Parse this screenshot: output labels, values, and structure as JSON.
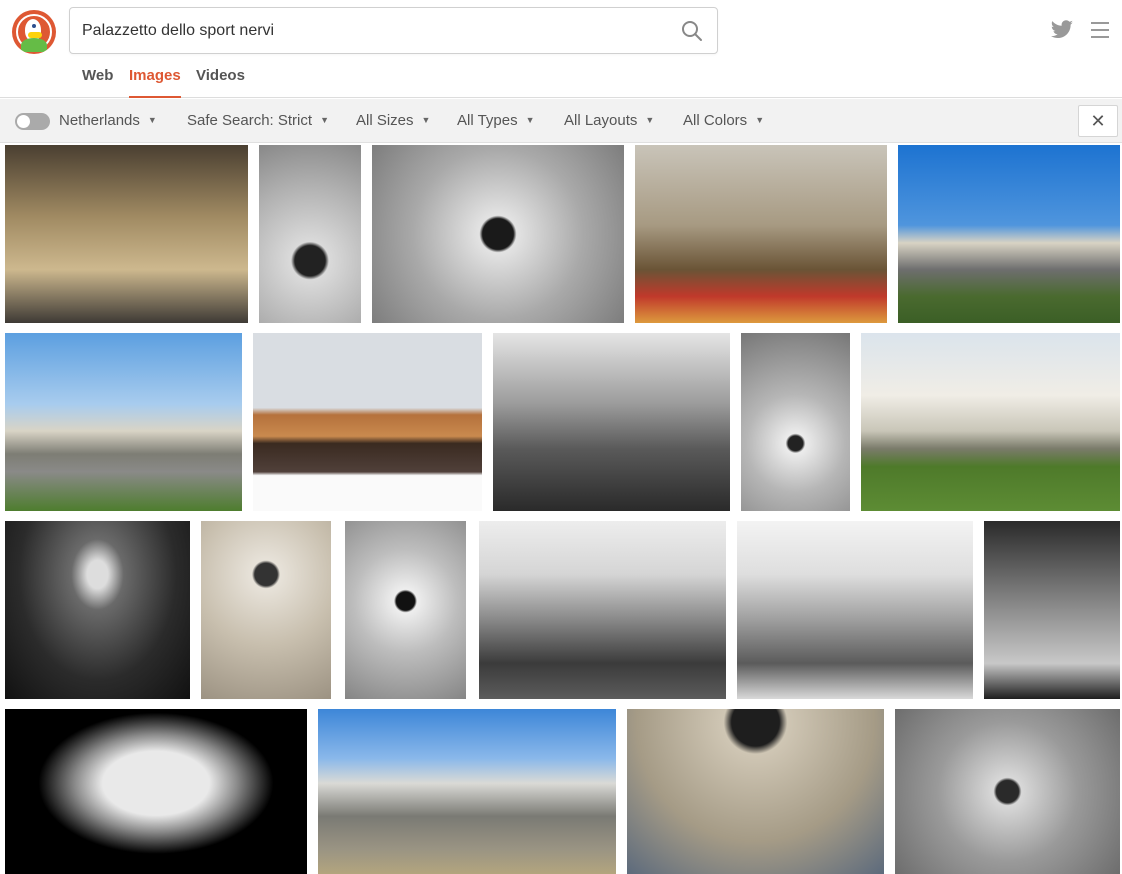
{
  "search": {
    "query": "Palazzetto dello sport nervi"
  },
  "tabs": [
    {
      "label": "Web",
      "active": false
    },
    {
      "label": "Images",
      "active": true
    },
    {
      "label": "Videos",
      "active": false
    }
  ],
  "filters": {
    "region": "Netherlands",
    "safe_search": "Safe Search: Strict",
    "size": "All Sizes",
    "type": "All Types",
    "layout": "All Layouts",
    "color": "All Colors"
  },
  "icons": {
    "search": "search-icon",
    "twitter": "twitter-icon",
    "menu": "hamburger-menu-icon",
    "close": "close-icon",
    "caret": "caret-down-icon"
  },
  "colors": {
    "accent": "#de5833",
    "filter_bar": "#f2f2f2",
    "text": "#555555"
  },
  "close_label": "✕",
  "caret": "▼"
}
